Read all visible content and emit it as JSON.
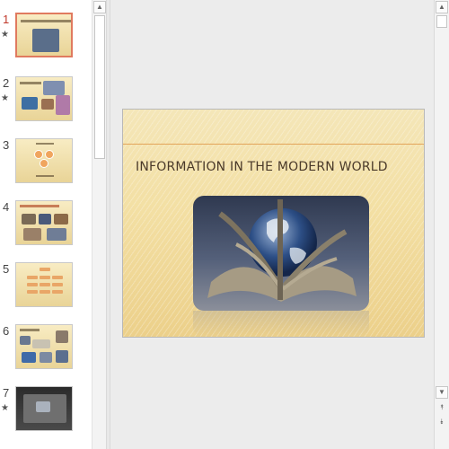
{
  "thumbnails": [
    {
      "number": "1",
      "has_animation": true,
      "active": true
    },
    {
      "number": "2",
      "has_animation": true,
      "active": false
    },
    {
      "number": "3",
      "has_animation": false,
      "active": false
    },
    {
      "number": "4",
      "has_animation": false,
      "active": false
    },
    {
      "number": "5",
      "has_animation": false,
      "active": false
    },
    {
      "number": "6",
      "has_animation": false,
      "active": false
    },
    {
      "number": "7",
      "has_animation": true,
      "active": false
    }
  ],
  "animation_marker": "★",
  "slide": {
    "title": "INFORMATION IN THE MODERN WORLD"
  },
  "scroll_glyphs": {
    "up": "▲",
    "down": "▼",
    "prev_slide": "⯭",
    "next_slide": "⯯"
  },
  "colors": {
    "active_border": "#e07a5f",
    "slide_accent_line": "#e2a45a",
    "title_text": "#4b3a2a"
  }
}
